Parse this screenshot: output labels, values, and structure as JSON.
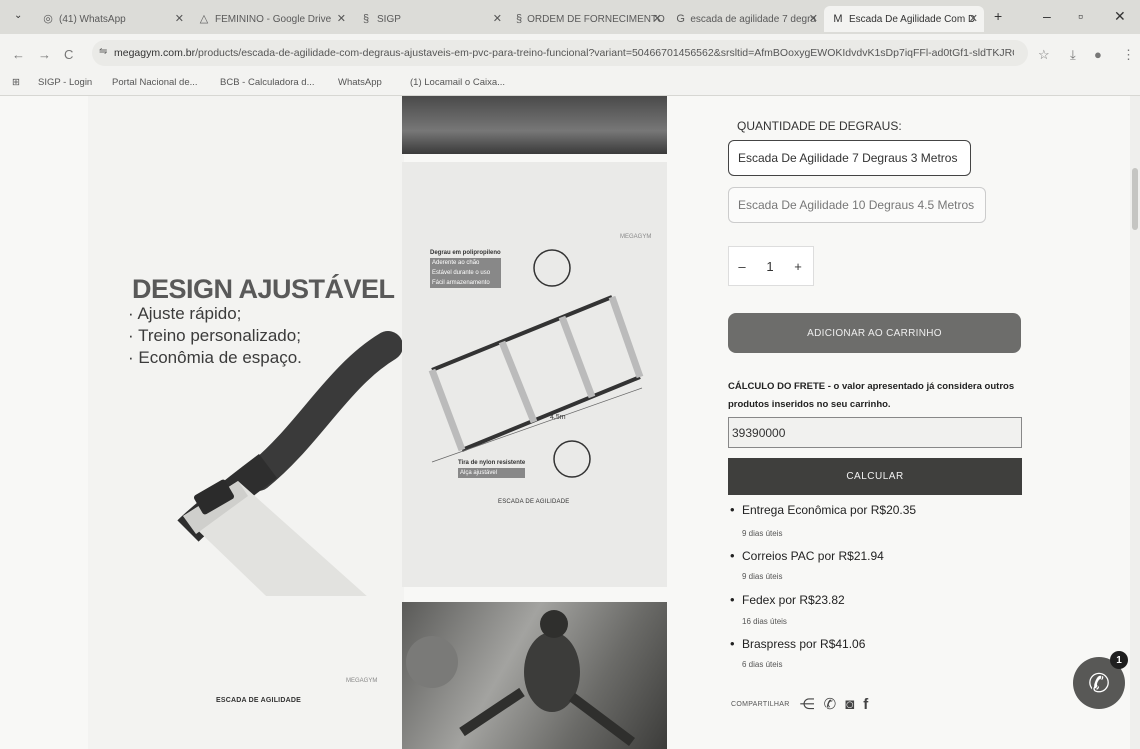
{
  "browser": {
    "tabs": [
      {
        "title": "(41) WhatsApp",
        "icon": "whatsapp-icon"
      },
      {
        "title": "FEMININO - Google Drive",
        "icon": "drive-icon"
      },
      {
        "title": "SIGP",
        "icon": "sigp-icon"
      },
      {
        "title": "ORDEM DE FORNECIMENTO",
        "icon": "sigp-icon"
      },
      {
        "title": "escada de agilidade 7 degra",
        "icon": "google-icon"
      },
      {
        "title": "Escada De Agilidade Com D",
        "icon": "megagym-icon"
      }
    ],
    "new_tab": "+",
    "window_controls": {
      "minimize": "–",
      "maximize": "▫",
      "close": "✕"
    },
    "url_host": "megagym.com.br",
    "url_path": "/products/escada-de-agilidade-com-degraus-ajustaveis-em-pvc-para-treino-funcional?variant=50466701456562&srsltid=AfmBOoxygEWOKIdvdvK1sDp7iqFFl-ad0tGf1-sldTKJRQ_tMeD1p...",
    "bookmarks": [
      "SIGP - Login",
      "Portal Nacional de...",
      "BCB - Calculadora d...",
      "WhatsApp",
      "(1) Locamail o Caixa..."
    ]
  },
  "product": {
    "feature_title": "DESIGN AJUSTÁVEL",
    "feature_bullets": [
      "· Ajuste rápido;",
      "· Treino personalizado;",
      "· Econômia de espaço."
    ],
    "left_caption": "ESCADA DE AGILIDADE",
    "brand_mark": "MEGAGYM",
    "diagram_labels": [
      "Degrau em polipropileno",
      "Aderente ao chão",
      "Estável durante o uso",
      "Fácil armazenamento",
      "Tira de nylon resistente",
      "Alça ajustável"
    ],
    "diagram_measure": "4,5m",
    "diagram_caption": "ESCADA DE AGILIDADE",
    "steps_label": "QUANTIDADE DE DEGRAUS:",
    "options": [
      "Escada De Agilidade 7 Degraus 3 Metros",
      "Escada De Agilidade 10 Degraus 4.5 Metros"
    ],
    "qty_minus": "–",
    "qty": "1",
    "qty_plus": "+",
    "add_to_cart": "ADICIONAR AO CARRINHO"
  },
  "shipping": {
    "title": "CÁLCULO DO FRETE - o valor apresentado já considera outros produtos inseridos no seu carrinho.",
    "cep": "39390000",
    "calc_button": "CALCULAR",
    "options": [
      {
        "name": "Entrega Econômica por R$20.35",
        "days": "9 dias úteis"
      },
      {
        "name": "Correios PAC por R$21.94",
        "days": "9 dias úteis"
      },
      {
        "name": "Fedex por R$23.82",
        "days": "16 dias úteis"
      },
      {
        "name": "Braspress por R$41.06",
        "days": "6 dias úteis"
      }
    ]
  },
  "share": {
    "label": "COMPARTILHAR"
  },
  "whatsapp_badge": "1"
}
